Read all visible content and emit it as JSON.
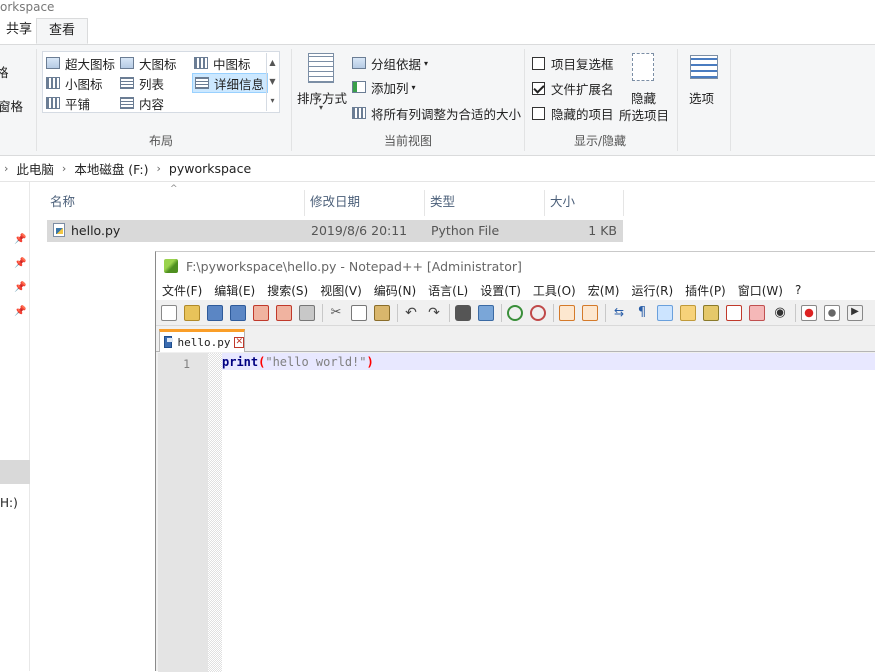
{
  "explorer": {
    "title": "orkspace",
    "tabs": {
      "share": "共享",
      "view": "查看"
    },
    "left_cut_labels": {
      "nav_pane_tail": "格",
      "pane_tail": "窗格"
    },
    "layout_group": {
      "label": "布局",
      "items": {
        "extra_large": "超大图标",
        "large": "大图标",
        "medium": "中图标",
        "small": "小图标",
        "list": "列表",
        "details": "详细信息",
        "tiles": "平铺",
        "content": "内容"
      }
    },
    "current_view_group": {
      "label": "当前视图",
      "sort_by": "排序方式",
      "group_by": "分组依据",
      "add_columns": "添加列",
      "size_all_columns": "将所有列调整为合适的大小"
    },
    "show_hide_group": {
      "label": "显示/隐藏",
      "item_checkboxes": {
        "label": "项目复选框",
        "checked": false
      },
      "file_extensions": {
        "label": "文件扩展名",
        "checked": true
      },
      "hidden_items": {
        "label": "隐藏的项目",
        "checked": false
      },
      "hide_selected_line1": "隐藏",
      "hide_selected_line2": "所选项目"
    },
    "options_label": "选项",
    "breadcrumb": [
      "此电脑",
      "本地磁盘 (F:)",
      "pyworkspace"
    ],
    "columns": [
      "名称",
      "修改日期",
      "类型",
      "大小"
    ],
    "files": [
      {
        "name": "hello.py",
        "modified": "2019/8/6 20:11",
        "type": "Python File",
        "size": "1 KB"
      }
    ],
    "nav_drive_label": "H:)"
  },
  "notepadpp": {
    "title": "F:\\pyworkspace\\hello.py - Notepad++ [Administrator]",
    "menus": [
      "文件(F)",
      "编辑(E)",
      "搜索(S)",
      "视图(V)",
      "编码(N)",
      "语言(L)",
      "设置(T)",
      "工具(O)",
      "宏(M)",
      "运行(R)",
      "插件(P)",
      "窗口(W)",
      "?"
    ],
    "tab_label": "hello.py",
    "line_number": "1",
    "code": {
      "keyword": "print",
      "open_paren": "(",
      "string": "\"hello world!\"",
      "close_paren": ")"
    }
  },
  "colors": {
    "accent_selection": "#cce8ff",
    "tab_highlight": "#fa9e28",
    "keyword": "#000080",
    "current_line": "#e8e8ff"
  }
}
